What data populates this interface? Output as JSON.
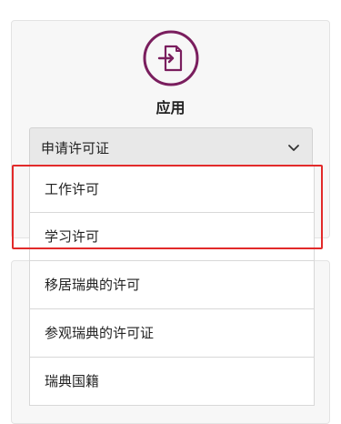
{
  "card": {
    "title": "应用",
    "icon": "sign-in-document-icon"
  },
  "select": {
    "selected_label": "申请许可证"
  },
  "dropdown": {
    "options": [
      {
        "label": "工作许可"
      },
      {
        "label": "学习许可"
      },
      {
        "label": "移居瑞典的许可"
      },
      {
        "label": "参观瑞典的许可证"
      },
      {
        "label": "瑞典国籍"
      }
    ]
  },
  "colors": {
    "icon_accent": "#7a1e5e",
    "highlight": "#e22a2a",
    "card_bg": "#f7f7f7",
    "select_bg": "#e8e8e8"
  }
}
